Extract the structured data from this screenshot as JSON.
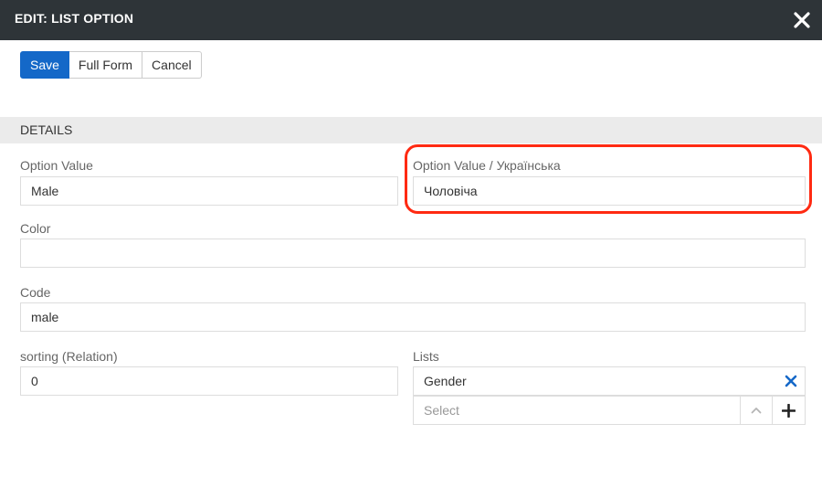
{
  "dialog": {
    "title": "EDIT: LIST OPTION",
    "colors": {
      "header_bg": "#2e3438",
      "primary": "#1468c8",
      "highlight": "#ff2a12"
    }
  },
  "toolbar": {
    "save_label": "Save",
    "full_form_label": "Full Form",
    "cancel_label": "Cancel"
  },
  "section": {
    "title": "DETAILS"
  },
  "fields": {
    "option_value": {
      "label": "Option Value",
      "value": "Male"
    },
    "option_value_uk": {
      "label": "Option Value / Українська",
      "value": "Чоловіча"
    },
    "color": {
      "label": "Color",
      "value": ""
    },
    "code": {
      "label": "Code",
      "value": "male"
    },
    "sorting": {
      "label": "sorting (Relation)",
      "value": "0"
    },
    "lists": {
      "label": "Lists",
      "selected": [
        "Gender"
      ],
      "select_placeholder": "Select"
    }
  },
  "icons": {
    "close": "close-icon",
    "remove": "remove-x-icon",
    "chevron": "chevron-up-icon",
    "add": "plus-icon"
  }
}
